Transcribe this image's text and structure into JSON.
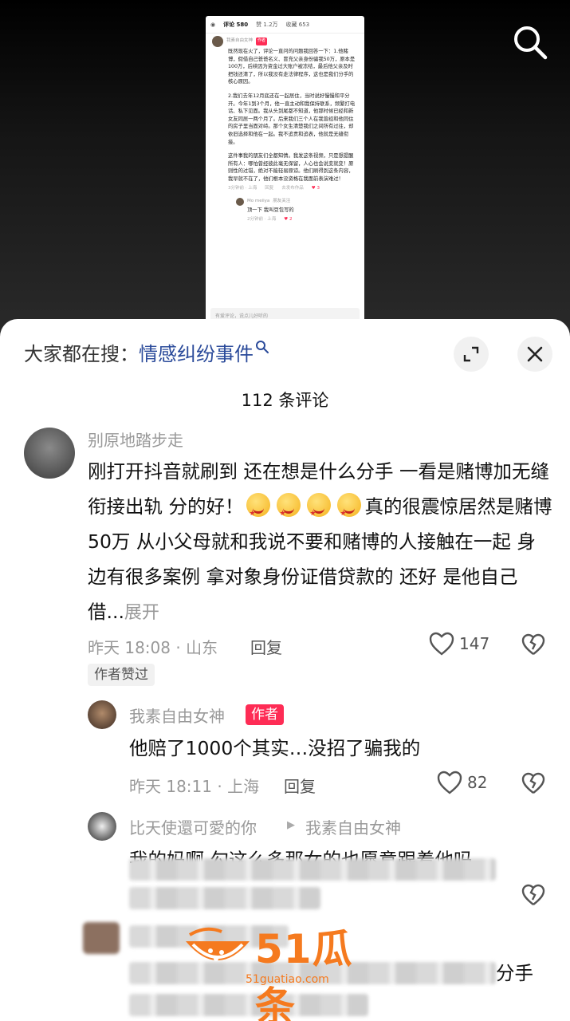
{
  "preview_screenshot": {
    "tabs": [
      "评论 580",
      "赞 1.2万",
      "收藏 653"
    ],
    "author_name": "我素自由女神",
    "author_tag": "作者",
    "paragraphs": [
      "既然现在火了，评论一直问的问题我回答一下：1.他赌博，假借自己爸爸名义、冒充父亲身份骗我50万，原本是100万，后续因为资金过大账户被冻结，最后他父亲及时把钱还清了，所以我没有走法律程序，这也是我们分手的核心原因。",
      "2.我们去年12月底还在一起居住，当时说好慢慢和平分开。今年1到3个月，他一直主动和我保持联系，频繁打电话、私下见面。我从头到尾都不知道，他那时候已经和新女友同居一两个月了。后来我们三个人在我曾经和他同住的房子里当面对峙。那个女生清楚我们之间所有过往，却依旧选择和他在一起。我不追责和追表，他就是无缝衔接。",
      "这件事我的朋友们全都知情。我发这条视频，只是想提醒所有人：哪怕曾经彼此毫无保留，人心也会说变就变！原则性的过错，绝对不能轻易原谅。他们刷得到这条内容，我早就不在了，他们根本没资格在我面前表演难过！"
    ],
    "meta": [
      "3分钟前 · 上海",
      "回复",
      "去发布作品"
    ],
    "likes": "3",
    "reply_name": "Mo meiiya",
    "reply_tag": "朋友关注",
    "reply_text": "顶一下 我叫豆包写的",
    "reply_meta": "2分钟前 · 上海",
    "reply_likes": "2",
    "input_placeholder": "有爱评论，说点儿好听的"
  },
  "sheet": {
    "search_prefix": "大家都在搜：",
    "search_topic": "情感纠纷事件",
    "comment_count": "112 条评论"
  },
  "comments": [
    {
      "name": "别原地踏步走",
      "text_a": "刚打开抖音就刷到 还在想是什么分手 一看是赌博加无缝衔接出轨 分的好！",
      "text_b": "真的很震惊居然是赌博50万 从小父母就和我说不要和赌博的人接触在一起 身边有很多案例 拿对象身份证借贷款的 还好 是他自己借...",
      "more": "展开",
      "time": "昨天 18:08 · 山东",
      "reply": "回复",
      "likes": "147",
      "liked_tag": "作者赞过"
    },
    {
      "name": "我素自由女神",
      "tag": "作者",
      "text": "他赔了1000个其实…没招了骗我的",
      "time": "昨天 18:11 · 上海",
      "reply": "回复",
      "likes": "82"
    },
    {
      "name": "比天使還可愛的你",
      "reply_to": "我素自由女神",
      "text": "我的妈啊 勾这么多那女的也愿意跟着他吗"
    }
  ],
  "trailing_text": "分手",
  "watermark": {
    "brand": "51瓜条",
    "url": "51guatiao.com"
  },
  "colors": {
    "accent": "#fe2c55",
    "topic": "#2a4a9a",
    "watermark": "#f57a1f"
  }
}
